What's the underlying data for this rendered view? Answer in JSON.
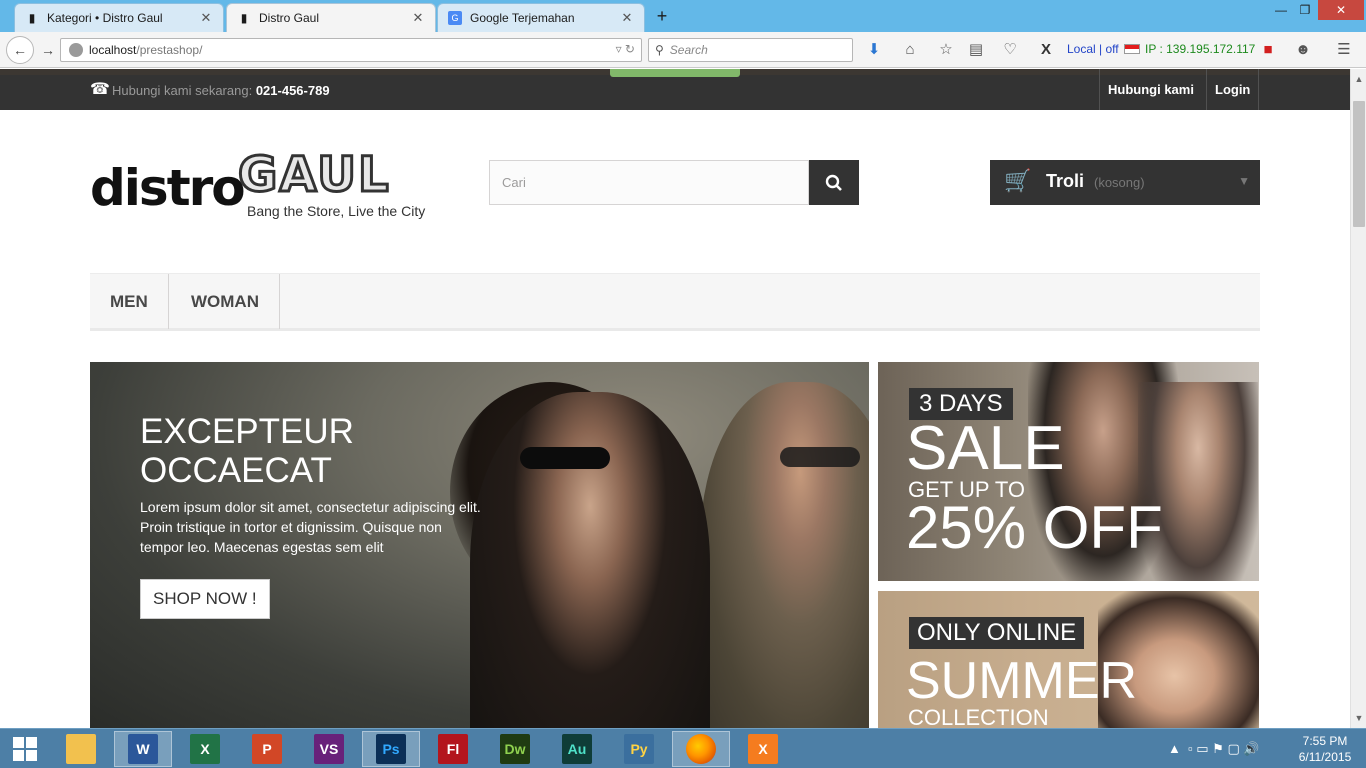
{
  "browser": {
    "tabs": [
      {
        "label": "Kategori • Distro Gaul",
        "active": false
      },
      {
        "label": "Distro Gaul",
        "active": true
      },
      {
        "label": "Google Terjemahan",
        "active": false
      }
    ],
    "new_tab": "+",
    "url_host": "localhost",
    "url_path": "/prestashop/",
    "search_placeholder": "Search",
    "local_status": "Local | off",
    "ip_text": "IP : 139.195.172.117"
  },
  "topbar": {
    "contact_prefix": "Hubungi kami sekarang:",
    "phone": "021-456-789",
    "links": [
      "Hubungi kami",
      "Login"
    ]
  },
  "header": {
    "logo_word1": "distro",
    "logo_word2": "GAUL",
    "logo_tagline": "Bang the Store, Live the City",
    "search_placeholder": "Cari",
    "cart_label": "Troli",
    "cart_state": "(kosong)"
  },
  "menu": {
    "items": [
      "MEN",
      "WOMAN"
    ]
  },
  "hero": {
    "title_line1": "EXCEPTEUR",
    "title_line2": "OCCAECAT",
    "text": "Lorem ipsum dolor sit amet, consectetur adipiscing elit. Proin tristique in tortor et dignissim. Quisque non tempor leo. Maecenas egestas sem elit",
    "button": "SHOP NOW !"
  },
  "banner1": {
    "tag": "3 DAYS",
    "headline": "SALE",
    "sub": "GET UP TO",
    "offer": "25% OFF"
  },
  "banner2": {
    "tag": "ONLY ONLINE",
    "headline": "SUMMER",
    "sub": "COLLECTION"
  },
  "taskbar": {
    "apps": [
      {
        "name": "File Explorer",
        "icon": "folder-icon",
        "color": "#f2c14e"
      },
      {
        "name": "Word",
        "icon": "word-icon",
        "label": "W",
        "color": "#2b579a"
      },
      {
        "name": "Excel",
        "icon": "excel-icon",
        "label": "X",
        "color": "#217346"
      },
      {
        "name": "PowerPoint",
        "icon": "powerpoint-icon",
        "label": "P",
        "color": "#d24726"
      },
      {
        "name": "Visual Studio",
        "icon": "visual-studio-icon",
        "label": "VS",
        "color": "#68217a"
      },
      {
        "name": "Photoshop",
        "icon": "photoshop-icon",
        "label": "Ps",
        "color": "#0b2f57"
      },
      {
        "name": "Flash",
        "icon": "flash-icon",
        "label": "Fl",
        "color": "#b3151d"
      },
      {
        "name": "Dreamweaver",
        "icon": "dreamweaver-icon",
        "label": "Dw",
        "color": "#1f3b12"
      },
      {
        "name": "Audition",
        "icon": "audition-icon",
        "label": "Au",
        "color": "#0f3d38"
      },
      {
        "name": "Python",
        "icon": "python-icon",
        "label": "Py",
        "color": "#3b6f9e"
      },
      {
        "name": "Firefox",
        "icon": "firefox-icon",
        "label": "",
        "color": "#e66000"
      },
      {
        "name": "XAMPP",
        "icon": "xampp-icon",
        "label": "X",
        "color": "#f57c1f"
      }
    ],
    "time": "7:55 PM",
    "date": "6/11/2015"
  }
}
